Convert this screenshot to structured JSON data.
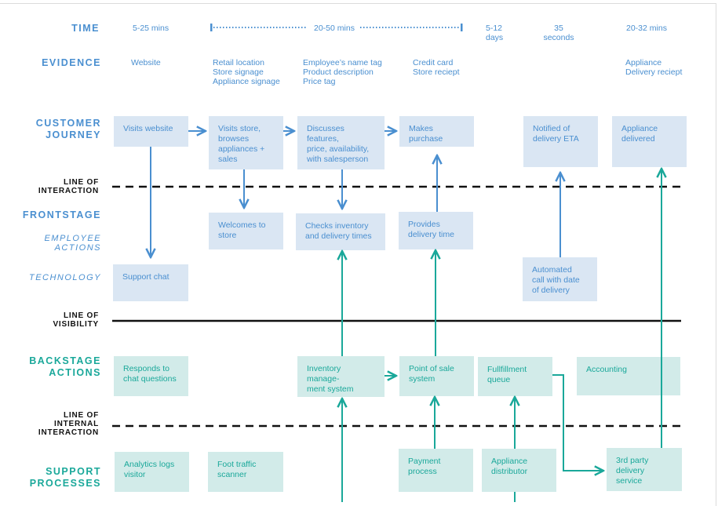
{
  "rows": {
    "time": "TIME",
    "evidence": "EVIDENCE",
    "customer_journey": [
      "CUSTOMER",
      "JOURNEY"
    ],
    "frontstage": "FRONTSTAGE",
    "employee_actions": [
      "EMPLOYEE",
      "ACTIONS"
    ],
    "technology": "TECHNOLOGY",
    "backstage_actions": [
      "BACKSTAGE",
      "ACTIONS"
    ],
    "support_processes": [
      "SUPPORT",
      "PROCESSES"
    ]
  },
  "lines": {
    "interaction": [
      "LINE OF",
      "INTERACTION"
    ],
    "visibility": [
      "LINE OF",
      "VISIBILITY"
    ],
    "internal_interaction": [
      "LINE OF",
      "INTERNAL",
      "INTERACTION"
    ]
  },
  "time": [
    "5-25 mins",
    "20-50 mins",
    "5-12\ndays",
    "35\nseconds",
    "20-32 mins"
  ],
  "evidence": [
    "Website",
    "Retail location\nStore signage\nAppliance signage",
    "Employee’s name tag\nProduct description\nPrice tag",
    "Credit card\nStore reciept",
    "Appliance\nDelivery reciept"
  ],
  "customer_journey": [
    "Visits website",
    "Visits store,\nbrowses\nappliances +\nsales",
    "Discusses features,\nprice, availability,\nwith salesperson",
    "Makes purchase",
    "Notified of\ndelivery ETA",
    "Appliance\ndelivered"
  ],
  "employee_actions": [
    "Welcomes to\nstore",
    "Checks inventory\nand delivery times",
    "Provides\ndelivery time"
  ],
  "technology": [
    "Support chat",
    "Automated\ncall with date\nof delivery"
  ],
  "backstage_actions": [
    "Responds to\nchat questions",
    "Inventory manage-\nment system",
    "Point of sale\nsystem",
    "Fullfillment\nqueue",
    "Accounting"
  ],
  "support_processes": [
    "Analytics logs\nvisitor",
    "Foot traffic\nscanner",
    "Payment\nprocess",
    "Appliance\ndistributor",
    "3rd party\ndelivery service"
  ],
  "colors": {
    "blue": "#4a8fd0",
    "teal": "#1aa89a",
    "blue_box": "#dae6f3",
    "teal_box": "#d2ebe9",
    "line": "#111111"
  }
}
